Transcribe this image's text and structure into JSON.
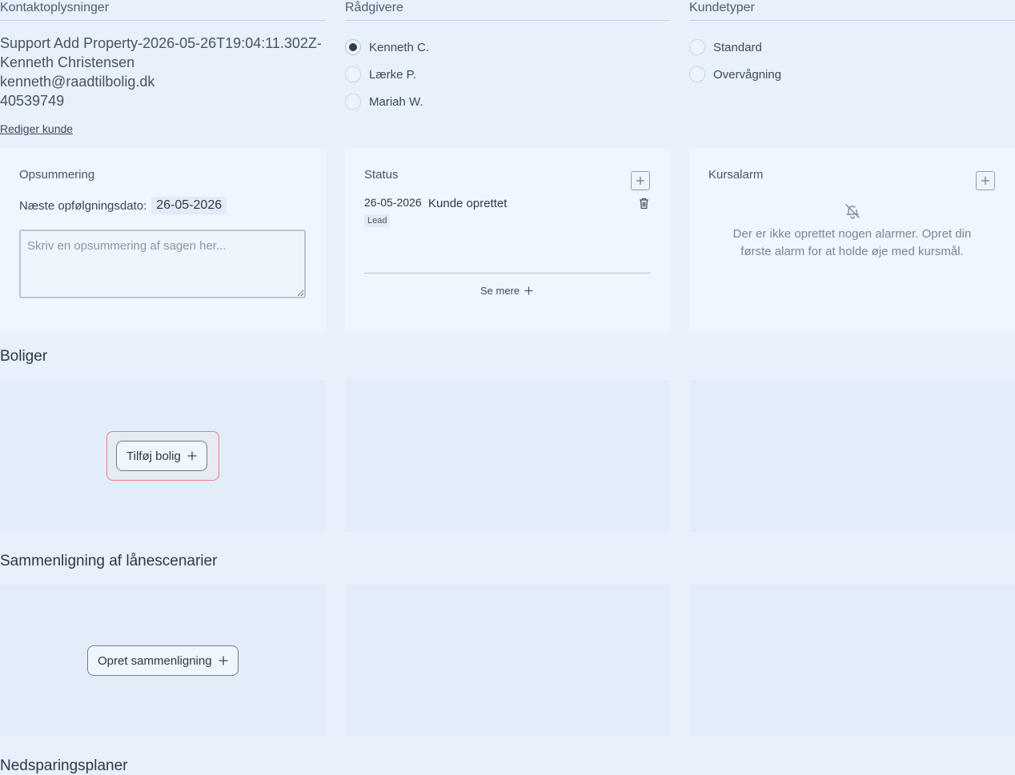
{
  "contact": {
    "label": "Kontaktoplysninger",
    "name_line": "Support Add Property-2026-05-26T19:04:11.302Z-",
    "person": "Kenneth Christensen",
    "email": "kenneth@raadtilbolig.dk",
    "phone": "40539749",
    "edit_link": "Rediger kunde"
  },
  "advisors": {
    "label": "Rådgivere",
    "options": [
      {
        "label": "Kenneth C.",
        "selected": true
      },
      {
        "label": "Lærke P.",
        "selected": false
      },
      {
        "label": "Mariah W.",
        "selected": false
      }
    ]
  },
  "customer_types": {
    "label": "Kundetyper",
    "options": [
      {
        "label": "Standard",
        "selected": false
      },
      {
        "label": "Overvågning",
        "selected": false
      }
    ]
  },
  "summary_card": {
    "title": "Opsummering",
    "followup_label": "Næste opfølgningsdato:",
    "followup_date": "26-05-2026",
    "placeholder": "Skriv en opsummering af sagen her..."
  },
  "status_card": {
    "title": "Status",
    "entry_date": "26-05-2026",
    "entry_text": "Kunde oprettet",
    "entry_badge": "Lead",
    "see_more": "Se mere"
  },
  "alarm_card": {
    "title": "Kursalarm",
    "empty_text": "Der er ikke oprettet nogen alarmer. Opret din første alarm for at holde øje med kursmål."
  },
  "properties": {
    "heading": "Boliger",
    "add_button": "Tilføj bolig"
  },
  "loan_comparison": {
    "heading": "Sammenligning af lånescenarier",
    "create_button": "Opret sammenligning"
  },
  "savings": {
    "heading": "Nedsparingsplaner"
  },
  "icons": {
    "plus": "plus-icon",
    "trash": "trash-icon",
    "bell_off": "bell-off-icon"
  }
}
